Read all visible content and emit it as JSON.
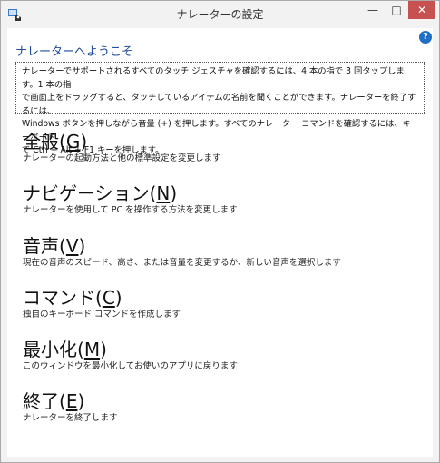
{
  "window": {
    "title": "ナレーターの設定",
    "controls": {
      "minimize": "—",
      "maximize": "□",
      "close": "✕"
    }
  },
  "help": {
    "glyph": "?"
  },
  "welcome": {
    "heading": "ナレーターへようこそ",
    "lines": [
      "ナレーターでサポートされるすべてのタッチ ジェスチャを確認するには、4 本の指で 3 回タップします。1 本の指",
      "で画面上をドラッグすると、タッチしているアイテムの名前を聞くことができます。ナレーターを終了するには、",
      "Windows ボタンを押しながら音量 (+) を押します。すべてのナレーター コマンドを確認するには、キーボード",
      "で Ctrl + Alt + F1 キーを押します。"
    ]
  },
  "sections": [
    {
      "label": "全般",
      "key": "G",
      "description": "ナレーターの起動方法と他の標準設定を変更します"
    },
    {
      "label": "ナビゲーション",
      "key": "N",
      "description": "ナレーターを使用して PC を操作する方法を変更します"
    },
    {
      "label": "音声",
      "key": "V",
      "description": "現在の音声のスピード、高さ、または音量を変更するか、新しい音声を選択します"
    },
    {
      "label": "コマンド",
      "key": "C",
      "description": "独自のキーボード コマンドを作成します"
    },
    {
      "label": "最小化",
      "key": "M",
      "description": "このウィンドウを最小化してお使いのアプリに戻ります"
    },
    {
      "label": "終了",
      "key": "E",
      "description": "ナレーターを終了します"
    }
  ]
}
